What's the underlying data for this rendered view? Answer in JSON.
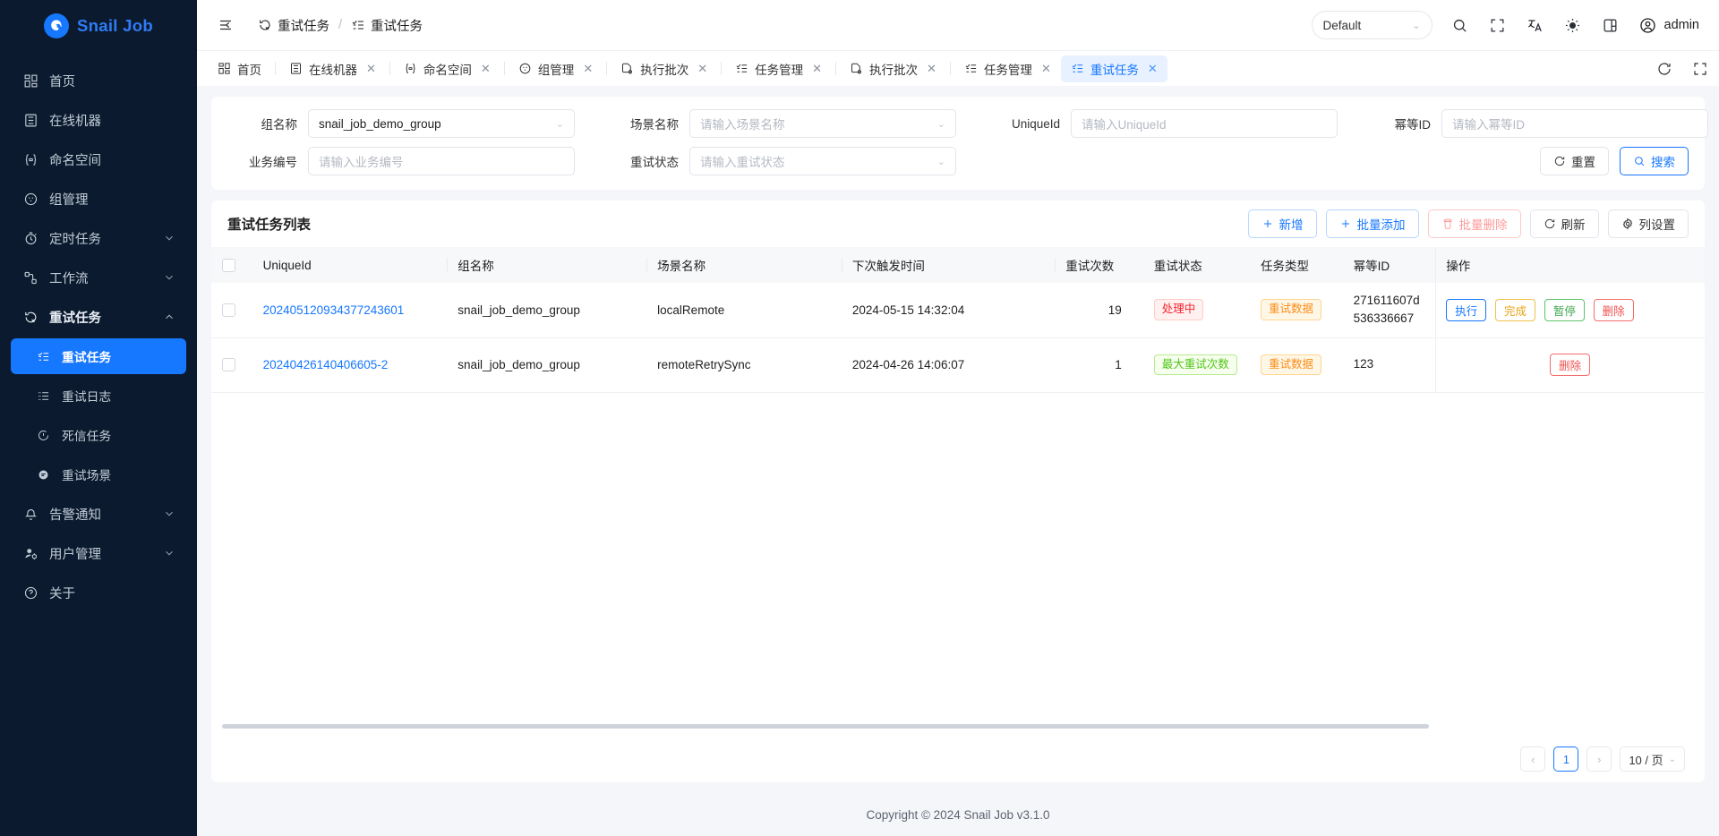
{
  "brand": {
    "name": "Snail Job",
    "color": "#2f7cf6"
  },
  "sidebar": {
    "items": [
      {
        "label": "首页",
        "icon": "dashboard-icon"
      },
      {
        "label": "在线机器",
        "icon": "server-icon"
      },
      {
        "label": "命名空间",
        "icon": "namespace-icon"
      },
      {
        "label": "组管理",
        "icon": "group-icon"
      },
      {
        "label": "定时任务",
        "icon": "timer-icon",
        "expandable": true
      },
      {
        "label": "工作流",
        "icon": "workflow-icon",
        "expandable": true
      },
      {
        "label": "重试任务",
        "icon": "retry-icon",
        "expandable": true,
        "expanded": true
      }
    ],
    "retry_children": [
      {
        "label": "重试任务",
        "icon": "checklist-icon",
        "active": true
      },
      {
        "label": "重试日志",
        "icon": "loglist-icon",
        "active": false
      },
      {
        "label": "死信任务",
        "icon": "warning-circle-icon",
        "active": false
      },
      {
        "label": "重试场景",
        "icon": "scene-icon",
        "active": false
      }
    ],
    "items_tail": [
      {
        "label": "告警通知",
        "icon": "bell-icon",
        "expandable": true
      },
      {
        "label": "用户管理",
        "icon": "user-gear-icon",
        "expandable": true
      },
      {
        "label": "关于",
        "icon": "question-icon"
      }
    ]
  },
  "topbar": {
    "collapse_icon": "menu-fold-icon",
    "breadcrumb": [
      {
        "label": "重试任务",
        "icon": "retry-icon"
      },
      {
        "label": "重试任务",
        "icon": "checklist-icon"
      }
    ],
    "breadcrumb_separator": "/",
    "theme_select": {
      "value": "Default",
      "caret": "⌄"
    },
    "icons": [
      "search-icon",
      "fullscreen-icon",
      "translate-icon",
      "sun-icon",
      "layout-icon"
    ],
    "user": {
      "name": "admin",
      "icon": "user-circle-icon"
    }
  },
  "tabs": {
    "items": [
      {
        "label": "首页",
        "icon": "dashboard-icon",
        "closable": false,
        "active": false
      },
      {
        "label": "在线机器",
        "icon": "server-icon",
        "closable": true,
        "active": false
      },
      {
        "label": "命名空间",
        "icon": "namespace-icon",
        "closable": true,
        "active": false
      },
      {
        "label": "组管理",
        "icon": "group-icon",
        "closable": true,
        "active": false
      },
      {
        "label": "执行批次",
        "icon": "batch-icon",
        "closable": true,
        "active": false
      },
      {
        "label": "任务管理",
        "icon": "checklist-icon",
        "closable": true,
        "active": false
      },
      {
        "label": "执行批次",
        "icon": "batch-icon",
        "closable": true,
        "active": false
      },
      {
        "label": "任务管理",
        "icon": "checklist-icon",
        "closable": true,
        "active": false
      },
      {
        "label": "重试任务",
        "icon": "checklist-icon",
        "closable": true,
        "active": true
      }
    ],
    "close_glyph": "✕",
    "right_icons": [
      "refresh-icon",
      "fullscreen-icon"
    ]
  },
  "filters": {
    "group_name": {
      "label": "组名称",
      "value": "snail_job_demo_group",
      "placeholder": "",
      "type": "select"
    },
    "scene_name": {
      "label": "场景名称",
      "value": "",
      "placeholder": "请输入场景名称",
      "type": "select"
    },
    "unique_id": {
      "label": "UniqueId",
      "value": "",
      "placeholder": "请输入UniqueId",
      "type": "input"
    },
    "idempotent_id": {
      "label": "幂等ID",
      "value": "",
      "placeholder": "请输入幂等ID",
      "type": "input"
    },
    "biz_no": {
      "label": "业务编号",
      "value": "",
      "placeholder": "请输入业务编号",
      "type": "input"
    },
    "retry_status": {
      "label": "重试状态",
      "value": "",
      "placeholder": "请输入重试状态",
      "type": "select"
    },
    "reset_button": {
      "label": "重置",
      "icon": "refresh-icon"
    },
    "search_button": {
      "label": "搜索",
      "icon": "search-icon"
    }
  },
  "table": {
    "title": "重试任务列表",
    "actions": [
      {
        "label": "新增",
        "icon": "plus-icon",
        "style": "blue-o"
      },
      {
        "label": "批量添加",
        "icon": "plus-icon",
        "style": "blue-o"
      },
      {
        "label": "批量删除",
        "icon": "trash-icon",
        "style": "red-o"
      },
      {
        "label": "刷新",
        "icon": "refresh-icon",
        "style": "plain"
      },
      {
        "label": "列设置",
        "icon": "gear-icon",
        "style": "plain"
      }
    ],
    "columns": [
      "UniqueId",
      "组名称",
      "场景名称",
      "下次触发时间",
      "重试次数",
      "重试状态",
      "任务类型",
      "幂等ID",
      "操作"
    ],
    "rows": [
      {
        "unique_id": "202405120934377243601",
        "group_name": "snail_job_demo_group",
        "scene_name": "localRemote",
        "next_trigger_time": "2024-05-15 14:32:04",
        "retry_count": "19",
        "retry_status": {
          "label": "处理中",
          "color": "red"
        },
        "task_type": {
          "label": "重试数据",
          "color": "orange"
        },
        "idempotent_id": "271611607d536336667",
        "operations": [
          {
            "label": "执行",
            "style": "mb-blue"
          },
          {
            "label": "完成",
            "style": "mb-yellow"
          },
          {
            "label": "暂停",
            "style": "mb-green"
          },
          {
            "label": "删除",
            "style": "mb-red"
          }
        ]
      },
      {
        "unique_id": "20240426140406605-2",
        "group_name": "snail_job_demo_group",
        "scene_name": "remoteRetrySync",
        "next_trigger_time": "2024-04-26 14:06:07",
        "retry_count": "1",
        "retry_status": {
          "label": "最大重试次数",
          "color": "green"
        },
        "task_type": {
          "label": "重试数据",
          "color": "orange"
        },
        "idempotent_id": "123",
        "operations": [
          {
            "label": "删除",
            "style": "mb-red"
          }
        ]
      }
    ]
  },
  "pagination": {
    "prev": "‹",
    "next": "›",
    "current_page": "1",
    "page_size": "10 / 页",
    "caret": "⌄"
  },
  "footer": {
    "text": "Copyright © 2024 Snail Job v3.1.0"
  }
}
